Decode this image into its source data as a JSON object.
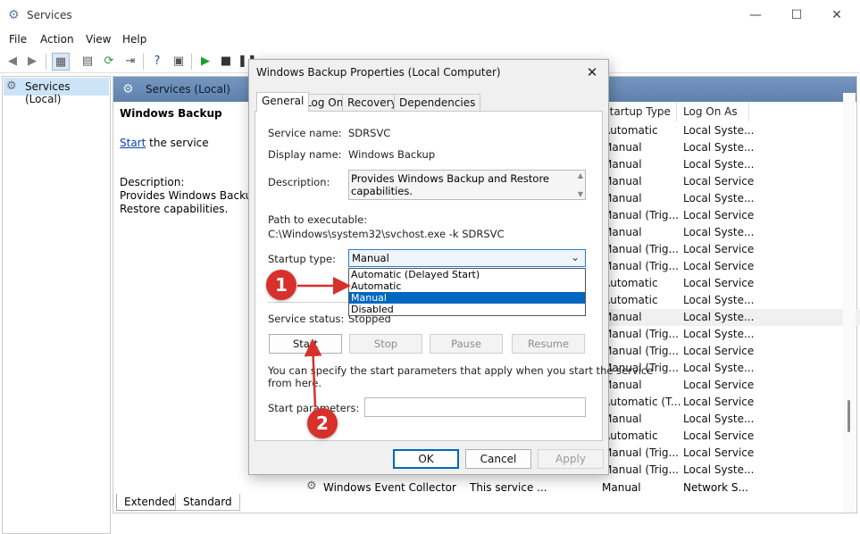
{
  "window": {
    "title": "Services",
    "controls": {
      "minimize": "—",
      "maximize": "☐",
      "close": "✕"
    }
  },
  "menu": [
    "File",
    "Action",
    "View",
    "Help"
  ],
  "tree": {
    "selected": "Services (Local)"
  },
  "content": {
    "header": "Services (Local)",
    "service_title": "Windows Backup",
    "start_link": "Start",
    "start_rest": " the service",
    "description_label": "Description:",
    "description_line1": "Provides Windows Backup a",
    "description_line2": "Restore capabilities.",
    "columns": {
      "startup_type": "Startup Type",
      "log_on_as": "Log On As"
    },
    "rows": [
      {
        "startup": "Automatic",
        "logon": "Local Syste..."
      },
      {
        "startup": "Manual",
        "logon": "Local Syste..."
      },
      {
        "startup": "Manual",
        "logon": "Local Syste..."
      },
      {
        "startup": "Manual",
        "logon": "Local Service"
      },
      {
        "startup": "Manual",
        "logon": "Local Syste..."
      },
      {
        "startup": "Manual (Trig...",
        "logon": "Local Service"
      },
      {
        "startup": "Manual",
        "logon": "Local Syste..."
      },
      {
        "startup": "Manual (Trig...",
        "logon": "Local Service"
      },
      {
        "startup": "Manual (Trig...",
        "logon": "Local Service"
      },
      {
        "startup": "Automatic",
        "logon": "Local Service"
      },
      {
        "startup": "Automatic",
        "logon": "Local Syste..."
      },
      {
        "startup": "Manual",
        "logon": "Local Syste..."
      },
      {
        "startup": "Manual (Trig...",
        "logon": "Local Syste..."
      },
      {
        "startup": "Manual (Trig...",
        "logon": "Local Service"
      },
      {
        "startup": "Manual (Trig...",
        "logon": "Local Syste..."
      },
      {
        "startup": "Manual",
        "logon": "Local Service"
      },
      {
        "startup": "Automatic (T...",
        "logon": "Local Service"
      },
      {
        "startup": "Manual",
        "logon": "Local Syste..."
      },
      {
        "startup": "Automatic",
        "logon": "Local Service"
      },
      {
        "startup": "Manual (Trig...",
        "logon": "Local Service"
      },
      {
        "startup": "Manual (Trig...",
        "logon": "Local Syste..."
      }
    ],
    "last_row": {
      "name": "Windows Event Collector",
      "description": "This service ...",
      "startup": "Manual",
      "logon": "Network S..."
    },
    "bottom_tabs": [
      "Extended",
      "Standard"
    ]
  },
  "dialog": {
    "title": "Windows Backup Properties (Local Computer)",
    "tabs": [
      "General",
      "Log On",
      "Recovery",
      "Dependencies"
    ],
    "service_name_label": "Service name:",
    "service_name": "SDRSVC",
    "display_name_label": "Display name:",
    "display_name": "Windows Backup",
    "description_label": "Description:",
    "description": "Provides Windows Backup and Restore capabilities.",
    "path_label": "Path to executable:",
    "path": "C:\\Windows\\system32\\svchost.exe -k SDRSVC",
    "startup_type_label": "Startup type:",
    "startup_type_value": "Manual",
    "startup_options": [
      "Automatic (Delayed Start)",
      "Automatic",
      "Manual",
      "Disabled"
    ],
    "status_label": "Service status:",
    "status_value": "Stopped",
    "buttons": {
      "start": "Start",
      "stop": "Stop",
      "pause": "Pause",
      "resume": "Resume"
    },
    "hint": "You can specify the start parameters that apply when you start the service",
    "hint2": "from here.",
    "params_label": "Start parameters:",
    "footer": {
      "ok": "OK",
      "cancel": "Cancel",
      "apply": "Apply"
    }
  },
  "annotations": {
    "badge1": "1",
    "badge2": "2",
    "color": "#d8302a"
  }
}
